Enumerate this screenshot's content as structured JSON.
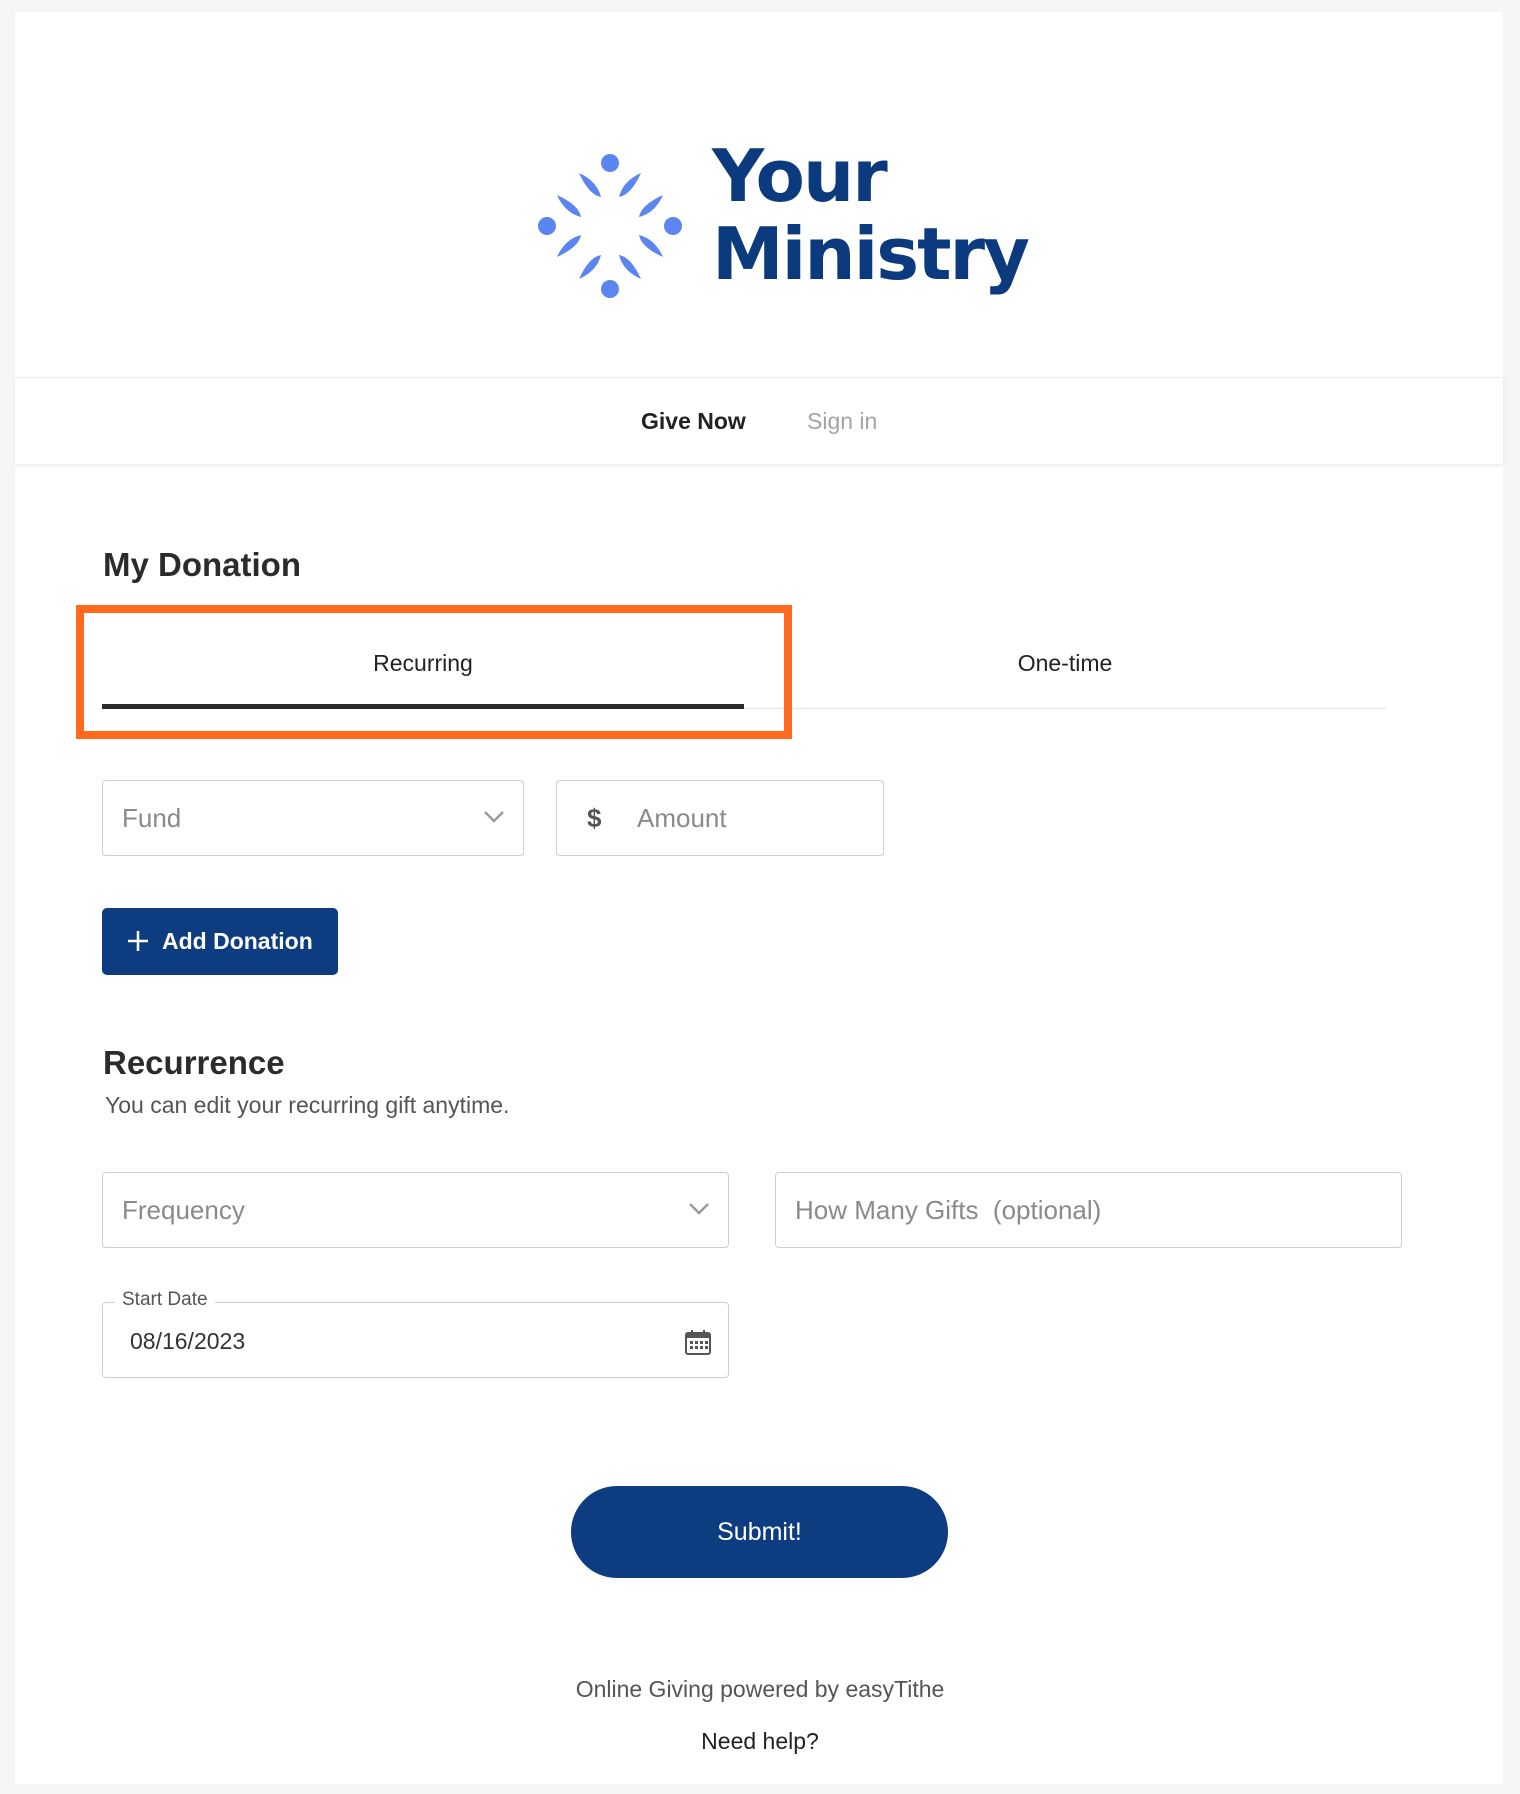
{
  "brand": {
    "name_line1": "Your",
    "name_line2": "Ministry",
    "color": "#0b3a7e",
    "mark_color": "#5b86f2"
  },
  "nav": {
    "items": [
      {
        "label": "Give Now",
        "active": true
      },
      {
        "label": "Sign in",
        "active": false
      }
    ]
  },
  "donation": {
    "title": "My Donation",
    "tabs": [
      {
        "label": "Recurring",
        "selected": true
      },
      {
        "label": "One-time",
        "selected": false
      }
    ],
    "highlight_color": "#ff6a1f",
    "fund": {
      "placeholder": "Fund",
      "icon": "chevron-down-icon"
    },
    "amount": {
      "currency_symbol": "$",
      "placeholder": "Amount"
    },
    "add_button": {
      "label": "Add Donation",
      "icon": "plus-icon"
    }
  },
  "recurrence": {
    "title": "Recurrence",
    "subtitle": "You can edit your recurring gift anytime.",
    "frequency": {
      "placeholder": "Frequency",
      "icon": "chevron-down-icon"
    },
    "gift_count": {
      "placeholder": "How Many Gifts  (optional)"
    },
    "start_date": {
      "label": "Start Date",
      "value": "08/16/2023",
      "icon": "calendar-icon"
    }
  },
  "submit": {
    "label": "Submit!",
    "color": "#0d3c80"
  },
  "footer": {
    "powered_by": "Online Giving powered by easyTithe",
    "help": "Need help?"
  }
}
